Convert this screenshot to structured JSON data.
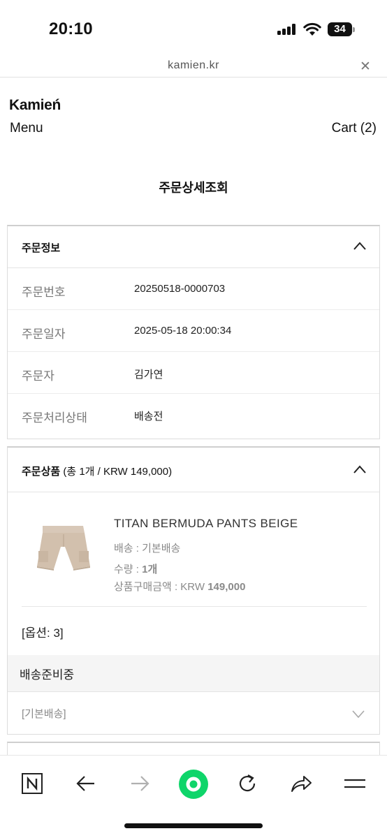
{
  "status_bar": {
    "time": "20:10",
    "battery_level": "34",
    "icons": [
      "signal-icon",
      "wifi-icon",
      "battery-icon"
    ]
  },
  "browser": {
    "url": "kamien.kr",
    "close_icon": "close-icon"
  },
  "site": {
    "logo": "Kamień",
    "menu_label": "Menu",
    "cart_label": "Cart (2)"
  },
  "page": {
    "title": "주문상세조회"
  },
  "order_info": {
    "title": "주문정보",
    "rows": [
      {
        "label": "주문번호",
        "value": "20250518-0000703"
      },
      {
        "label": "주문일자",
        "value": "2025-05-18 20:00:34"
      },
      {
        "label": "주문자",
        "value": "김가연"
      },
      {
        "label": "주문처리상태",
        "value": "배송전"
      }
    ]
  },
  "order_products": {
    "title": "주문상품",
    "summary": "(총 1개 / KRW 149,000)",
    "item": {
      "name": "TITAN BERMUDA PANTS BEIGE",
      "shipping_label": "배송 : 기본배송",
      "quantity_label": "수량 : ",
      "quantity_value": "1개",
      "price_label": "상품구매금액 : KRW ",
      "price_value": "149,000",
      "option": "[옵션: 3]",
      "status": "배송준비중",
      "shipping_type": "[기본배송]"
    }
  },
  "toolbar": {
    "items": [
      "naver-icon",
      "back-icon",
      "forward-icon",
      "green-dot-icon",
      "reload-icon",
      "share-icon",
      "menu-icon"
    ]
  },
  "colors": {
    "accent_green": "#0fd56a",
    "muted_text": "#8a8a8a",
    "border": "#dcdcdc"
  }
}
